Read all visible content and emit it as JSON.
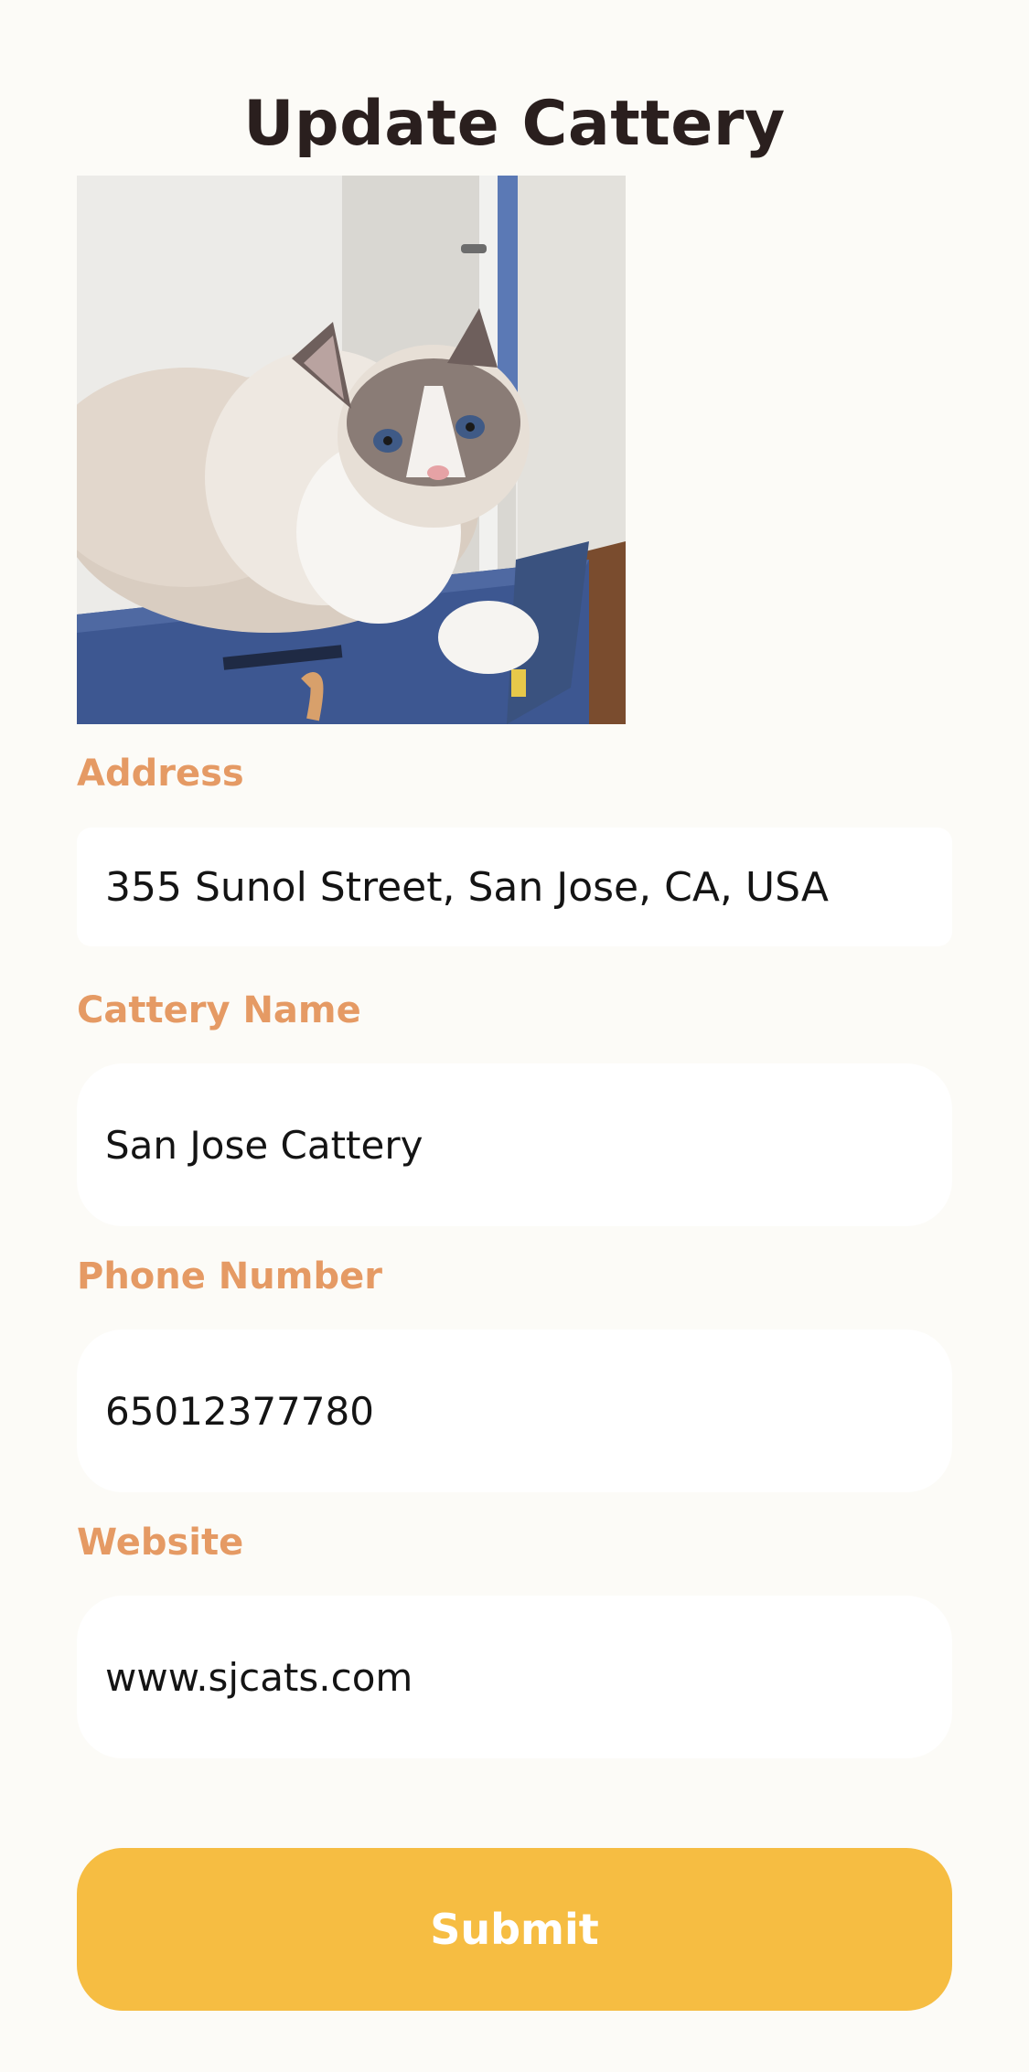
{
  "page": {
    "title": "Update Cattery"
  },
  "photo": {
    "alt": "cat lying on a blue cardboard box"
  },
  "form": {
    "address": {
      "label": "Address",
      "value": "355 Sunol Street, San Jose, CA, USA"
    },
    "cattery_name": {
      "label": "Cattery Name",
      "value": "San Jose Cattery"
    },
    "phone_number": {
      "label": "Phone Number",
      "value": "65012377780"
    },
    "website": {
      "label": "Website",
      "value": "www.sjcats.com"
    },
    "submit_label": "Submit"
  },
  "colors": {
    "background": "#fcfbf7",
    "title": "#2a1f1e",
    "label": "#e59a64",
    "field_background": "#ffffff",
    "submit_background": "#f6bd42",
    "submit_text": "#ffffff"
  }
}
